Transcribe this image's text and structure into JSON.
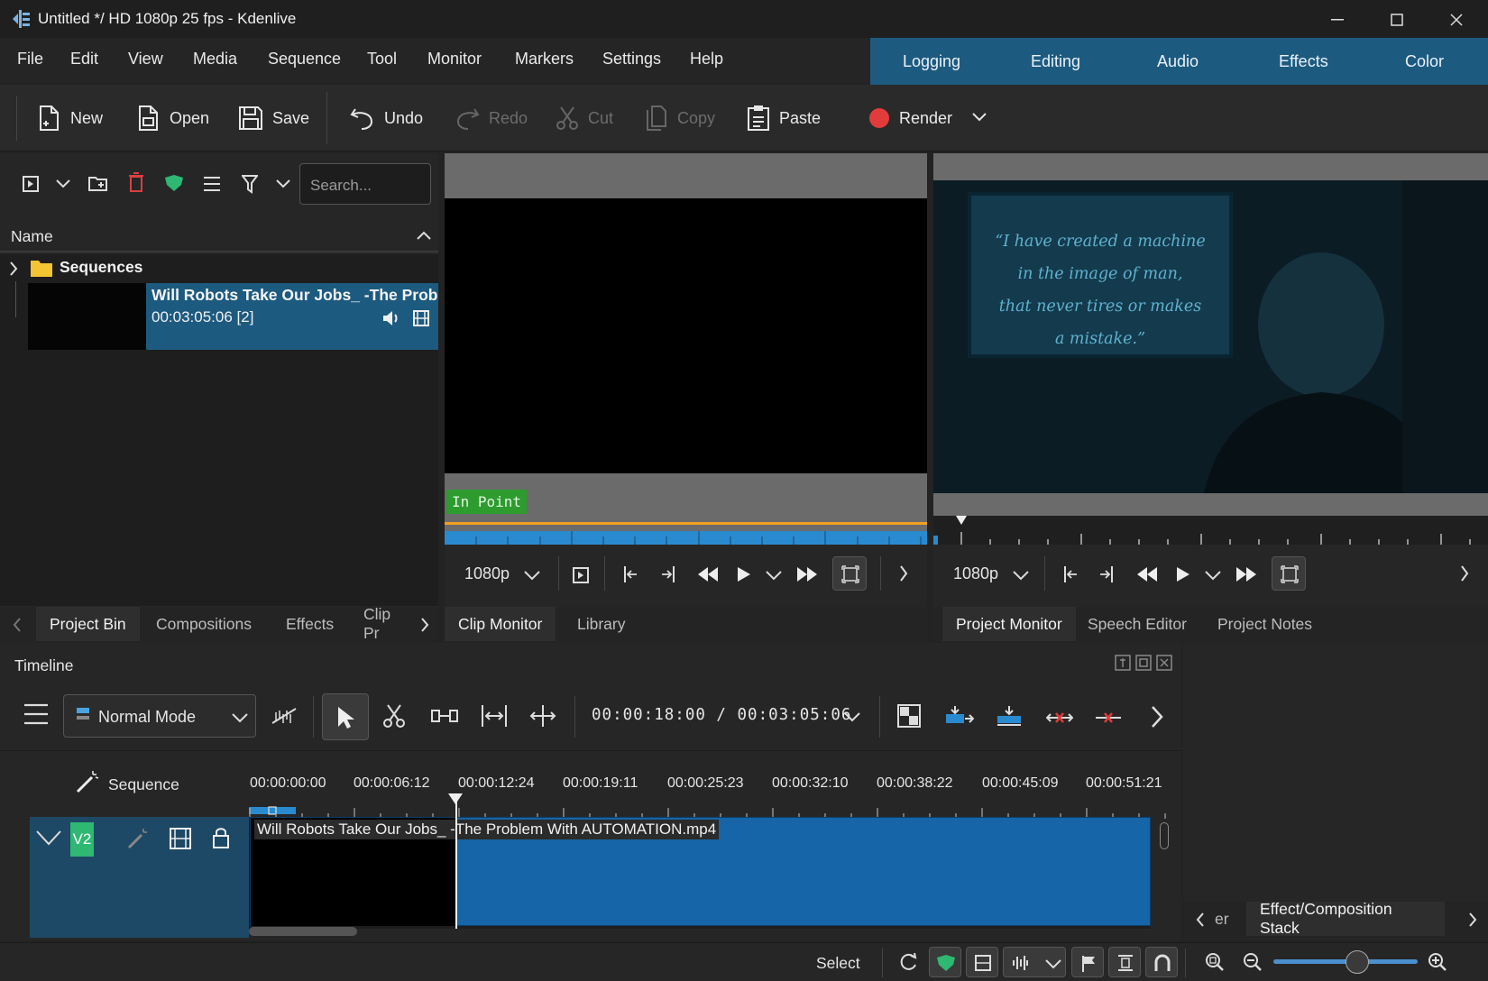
{
  "window": {
    "title": "Untitled */ HD 1080p 25 fps - Kdenlive"
  },
  "menu": [
    "File",
    "Edit",
    "View",
    "Media",
    "Sequence",
    "Tool",
    "Monitor",
    "Markers",
    "Settings",
    "Help"
  ],
  "workspaces": [
    "Logging",
    "Editing",
    "Audio",
    "Effects",
    "Color"
  ],
  "toolbar": {
    "new": "New",
    "open": "Open",
    "save": "Save",
    "undo": "Undo",
    "redo": "Redo",
    "cut": "Cut",
    "copy": "Copy",
    "paste": "Paste",
    "render": "Render"
  },
  "bin": {
    "search_placeholder": "Search...",
    "column_name": "Name",
    "folder": "Sequences",
    "clip_title": "Will Robots Take Our Jobs_ -The Probl",
    "clip_duration": "00:03:05:06 [2]",
    "tabs": [
      "Project Bin",
      "Compositions",
      "Effects",
      "Clip Pr"
    ]
  },
  "clip_monitor": {
    "in_point_label": "In Point",
    "resolution": "1080p",
    "tabs": [
      "Clip Monitor",
      "Library"
    ]
  },
  "project_monitor": {
    "resolution": "1080p",
    "tabs": [
      "Project Monitor",
      "Speech Editor",
      "Project Notes"
    ],
    "frame_text": [
      "“I have created a machine",
      "in the image of man,",
      "that never tires or makes",
      "a mistake.”"
    ]
  },
  "timeline": {
    "title": "Timeline",
    "mode": "Normal Mode",
    "timecode": "00:00:18:00 / 00:03:05:06",
    "sequence_label": "Sequence",
    "ruler": [
      "00:00:00:00",
      "00:00:06:12",
      "00:00:12:24",
      "00:00:19:11",
      "00:00:25:23",
      "00:00:32:10",
      "00:00:38:22",
      "00:00:45:09",
      "00:00:51:21"
    ],
    "track_label": "V2",
    "clip_name": "Will Robots Take Our Jobs_ -The Problem With AUTOMATION.mp4"
  },
  "effect_stack": {
    "title": "Effect/Composition Stack",
    "partial_tab": "er"
  },
  "status": {
    "mode": "Select"
  },
  "colors": {
    "accent": "#1d5a80",
    "clip_blue": "#1565a8",
    "track_green": "#2eb872",
    "in_point": "#2e9b2e",
    "render_red": "#e23b3b"
  }
}
